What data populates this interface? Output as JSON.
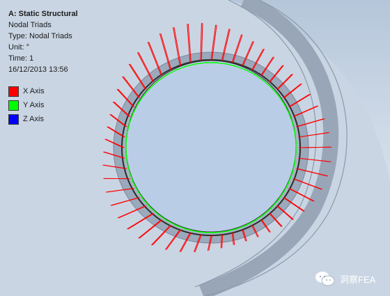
{
  "info": {
    "title": "A: Static Structural",
    "result": "Nodal Triads",
    "type": "Type: Nodal Triads",
    "unit": "Unit: °",
    "time": "Time: 1",
    "date": "16/12/2013 13:56"
  },
  "legend": [
    {
      "label": "X Axis",
      "color": "#ff0000"
    },
    {
      "label": "Y Axis",
      "color": "#00ff00"
    },
    {
      "label": "Z Axis",
      "color": "#0000ff"
    }
  ],
  "watermark": {
    "text": "洞察FEA",
    "icon": "wechat-icon"
  },
  "colors": {
    "background_top": "#b5c6da",
    "background_bottom": "#dfe7f0",
    "hole_fill": "#bacde6",
    "x_axis": "#ff0000",
    "y_axis": "#00ff00",
    "edge": "#333333"
  }
}
